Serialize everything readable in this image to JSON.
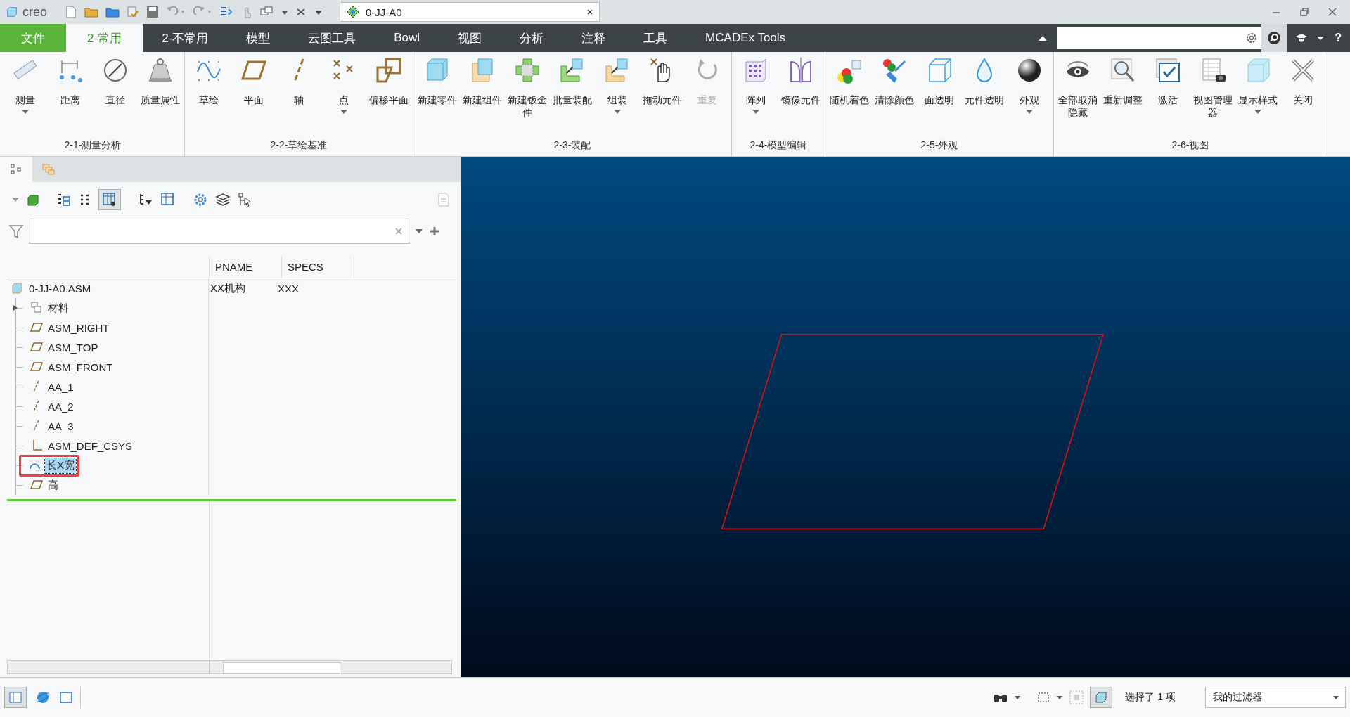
{
  "title_bar": {
    "logo": "creo",
    "document_tab": "0-JJ-A0"
  },
  "ribbon_tabs": [
    {
      "label": "文件",
      "kind": "file",
      "selected": false
    },
    {
      "label": "2-常用",
      "kind": "tab",
      "selected": true
    },
    {
      "label": "2-不常用",
      "kind": "tab",
      "selected": false
    },
    {
      "label": "模型",
      "kind": "tab",
      "selected": false
    },
    {
      "label": "云图工具",
      "kind": "tab",
      "selected": false
    },
    {
      "label": "Bowl",
      "kind": "tab",
      "selected": false
    },
    {
      "label": "视图",
      "kind": "tab",
      "selected": false
    },
    {
      "label": "分析",
      "kind": "tab",
      "selected": false
    },
    {
      "label": "注释",
      "kind": "tab",
      "selected": false
    },
    {
      "label": "工具",
      "kind": "tab",
      "selected": false
    },
    {
      "label": "MCADEx Tools",
      "kind": "tab",
      "selected": false
    }
  ],
  "help_label": "?",
  "ribbon_groups": [
    {
      "label": "2-1-测量分析",
      "commands": [
        {
          "label": "测量",
          "dropdown": true,
          "disabled": false
        },
        {
          "label": "距离",
          "dropdown": false,
          "disabled": false
        },
        {
          "label": "直径",
          "dropdown": false,
          "disabled": false
        },
        {
          "label": "质量属性",
          "dropdown": false,
          "disabled": false
        }
      ]
    },
    {
      "label": "2-2-草绘基准",
      "commands": [
        {
          "label": "草绘",
          "dropdown": false,
          "disabled": false
        },
        {
          "label": "平面",
          "dropdown": false,
          "disabled": false
        },
        {
          "label": "轴",
          "dropdown": false,
          "disabled": false
        },
        {
          "label": "点",
          "dropdown": true,
          "disabled": false
        },
        {
          "label": "偏移平面",
          "dropdown": false,
          "disabled": false
        }
      ]
    },
    {
      "label": "2-3-装配",
      "commands": [
        {
          "label": "新建零件",
          "dropdown": false,
          "disabled": false
        },
        {
          "label": "新建组件",
          "dropdown": false,
          "disabled": false
        },
        {
          "label": "新建钣金件",
          "dropdown": false,
          "disabled": false
        },
        {
          "label": "批量装配",
          "dropdown": false,
          "disabled": false
        },
        {
          "label": "组装",
          "dropdown": true,
          "disabled": false
        },
        {
          "label": "拖动元件",
          "dropdown": false,
          "disabled": false
        },
        {
          "label": "重复",
          "dropdown": false,
          "disabled": true
        }
      ]
    },
    {
      "label": "2-4-模型编辑",
      "commands": [
        {
          "label": "阵列",
          "dropdown": true,
          "disabled": false
        },
        {
          "label": "镜像元件",
          "dropdown": false,
          "disabled": false
        }
      ]
    },
    {
      "label": "2-5-外观",
      "commands": [
        {
          "label": "随机着色",
          "dropdown": false,
          "disabled": false
        },
        {
          "label": "清除颜色",
          "dropdown": false,
          "disabled": false
        },
        {
          "label": "面透明",
          "dropdown": false,
          "disabled": false
        },
        {
          "label": "元件透明",
          "dropdown": false,
          "disabled": false
        },
        {
          "label": "外观",
          "dropdown": true,
          "disabled": false
        }
      ]
    },
    {
      "label": "2-6-视图",
      "commands": [
        {
          "label": "全部取消隐藏",
          "dropdown": false,
          "disabled": false
        },
        {
          "label": "重新调整",
          "dropdown": false,
          "disabled": false
        },
        {
          "label": "激活",
          "dropdown": false,
          "disabled": false
        },
        {
          "label": "视图管理器",
          "dropdown": false,
          "disabled": false
        },
        {
          "label": "显示样式",
          "dropdown": true,
          "disabled": false
        },
        {
          "label": "关闭",
          "dropdown": false,
          "disabled": false
        }
      ]
    }
  ],
  "model_tree": {
    "columns": [
      "PNAME",
      "SPECS"
    ],
    "root": {
      "label": "0-JJ-A0.ASM",
      "kind": "assembly",
      "pname": "XX机构",
      "specs": "XXX",
      "selected": false,
      "marked": false,
      "children": [
        {
          "label": "材料",
          "kind": "layer",
          "expanded": false,
          "selected": false,
          "marked": false
        },
        {
          "label": "ASM_RIGHT",
          "kind": "plane",
          "selected": false,
          "marked": false
        },
        {
          "label": "ASM_TOP",
          "kind": "plane",
          "selected": false,
          "marked": false
        },
        {
          "label": "ASM_FRONT",
          "kind": "plane",
          "selected": false,
          "marked": false
        },
        {
          "label": "AA_1",
          "kind": "axis",
          "selected": false,
          "marked": false
        },
        {
          "label": "AA_2",
          "kind": "axis",
          "selected": false,
          "marked": false
        },
        {
          "label": "AA_3",
          "kind": "axis",
          "selected": false,
          "marked": false
        },
        {
          "label": "ASM_DEF_CSYS",
          "kind": "csys",
          "selected": false,
          "marked": false
        },
        {
          "label": "长X宽",
          "kind": "sketch",
          "selected": true,
          "marked": true
        },
        {
          "label": "高",
          "kind": "plane",
          "selected": false,
          "marked": false
        }
      ]
    }
  },
  "status_bar": {
    "selection": "选择了 1 项",
    "filter": "我的过滤器"
  }
}
